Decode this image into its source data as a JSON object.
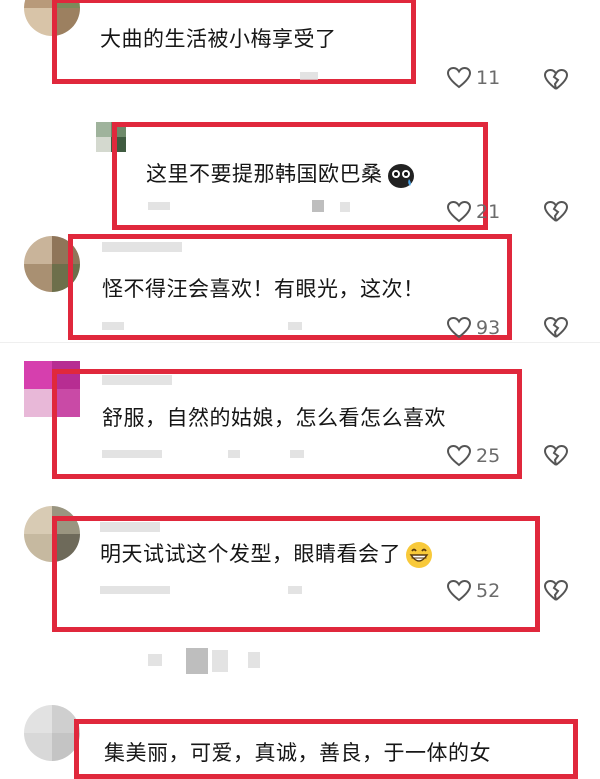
{
  "comments": [
    {
      "text": "大曲的生活被小梅享受了",
      "likes": "11"
    },
    {
      "text": "这里不要提那韩国欧巴桑",
      "likes": "21"
    },
    {
      "text": "怪不得汪会喜欢！有眼光，这次！",
      "likes": "93"
    },
    {
      "text": "舒服，自然的姑娘，怎么看怎么喜欢",
      "likes": "25"
    },
    {
      "text": "明天试试这个发型，眼睛看会了",
      "likes": "52"
    },
    {
      "text": "集美丽，可爱，真诚，善良，于一体的女"
    }
  ],
  "icons": {
    "like": "heart-outline-icon",
    "dislike": "broken-heart-icon",
    "emoji_dark": "dark-blob-emoji",
    "emoji_grin": "grinning-face-emoji"
  },
  "colors": {
    "highlight": "#e0283c",
    "text": "#161616",
    "meta": "#6b6b6b"
  }
}
